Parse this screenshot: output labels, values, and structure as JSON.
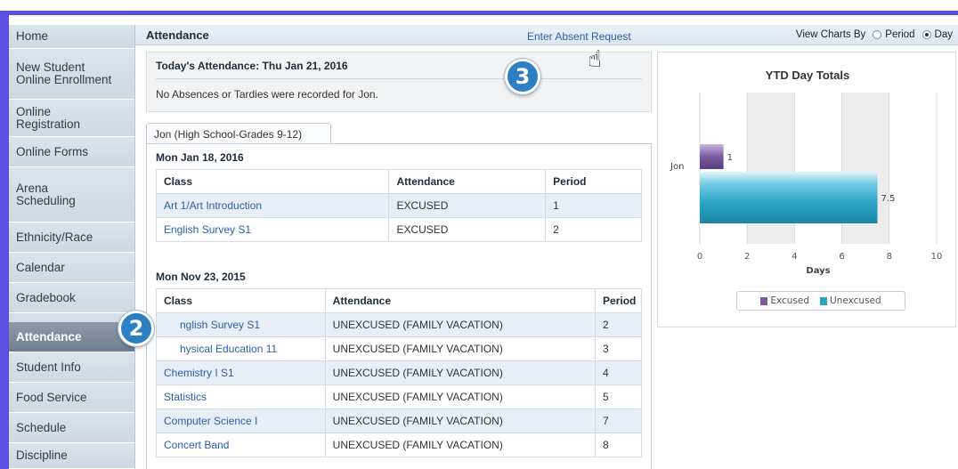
{
  "sidebar": {
    "items": [
      {
        "label": "Home"
      },
      {
        "label": "New Student Online Enrollment"
      },
      {
        "label": "Online Registration"
      },
      {
        "label": "Online Forms"
      },
      {
        "label": "Arena Scheduling"
      },
      {
        "label": "Ethnicity/Race"
      },
      {
        "label": "Calendar"
      },
      {
        "label": "Gradebook"
      },
      {
        "label": "Attendance"
      },
      {
        "label": "Student Info"
      },
      {
        "label": "Food Service"
      },
      {
        "label": "Schedule"
      },
      {
        "label": "Discipline"
      }
    ],
    "active_index": 8
  },
  "header": {
    "title": "Attendance",
    "absent_request_link": "Enter Absent Request",
    "view_charts_label": "View Charts By",
    "view_options": [
      "Period",
      "Day"
    ],
    "view_selected": "Day"
  },
  "today": {
    "title": "Today's Attendance: Thu Jan 21, 2016",
    "message": "No Absences or Tardies were recorded for Jon."
  },
  "student_tab": "Jon (High School-Grades 9-12)",
  "days": [
    {
      "date": "Mon Jan 18, 2016",
      "headers": [
        "Class",
        "Attendance",
        "Period"
      ],
      "rows": [
        {
          "class": "Art 1/Art Introduction",
          "attendance": "EXCUSED",
          "period": "1"
        },
        {
          "class": "English Survey S1",
          "attendance": "EXCUSED",
          "period": "2"
        }
      ]
    },
    {
      "date": "Mon Nov 23, 2015",
      "headers": [
        "Class",
        "Attendance",
        "Period"
      ],
      "rows": [
        {
          "class": "nglish Survey S1",
          "attendance": "UNEXCUSED (FAMILY VACATION)",
          "period": "2"
        },
        {
          "class": "hysical Education 11",
          "attendance": "UNEXCUSED (FAMILY VACATION)",
          "period": "3"
        },
        {
          "class": "Chemistry I S1",
          "attendance": "UNEXCUSED (FAMILY VACATION)",
          "period": "4"
        },
        {
          "class": "Statistics",
          "attendance": "UNEXCUSED (FAMILY VACATION)",
          "period": "5"
        },
        {
          "class": "Computer Science I",
          "attendance": "UNEXCUSED (FAMILY VACATION)",
          "period": "7"
        },
        {
          "class": "Concert Band",
          "attendance": "UNEXCUSED (FAMILY VACATION)",
          "period": "8"
        }
      ]
    }
  ],
  "callouts": {
    "badge_2": "2",
    "badge_3": "3"
  },
  "chart_data": {
    "type": "bar",
    "orientation": "horizontal",
    "title": "YTD Day Totals",
    "categories": [
      "Jon"
    ],
    "series": [
      {
        "name": "Excused",
        "values": [
          1
        ],
        "labels": [
          "1"
        ],
        "color": "#7b5aa0"
      },
      {
        "name": "Unexcused",
        "values": [
          7.5
        ],
        "labels": [
          "7.5"
        ],
        "color": "#2aa4c6"
      }
    ],
    "xlabel": "Days",
    "xlim": [
      0,
      10
    ],
    "xticks": [
      0,
      2,
      4,
      6,
      8,
      10
    ],
    "legend_position": "bottom"
  },
  "colors": {
    "frame": "#5b4fe0",
    "link": "#2a5fa8",
    "badge": "#2d7fc4",
    "active_nav": "#7b8a9d"
  }
}
